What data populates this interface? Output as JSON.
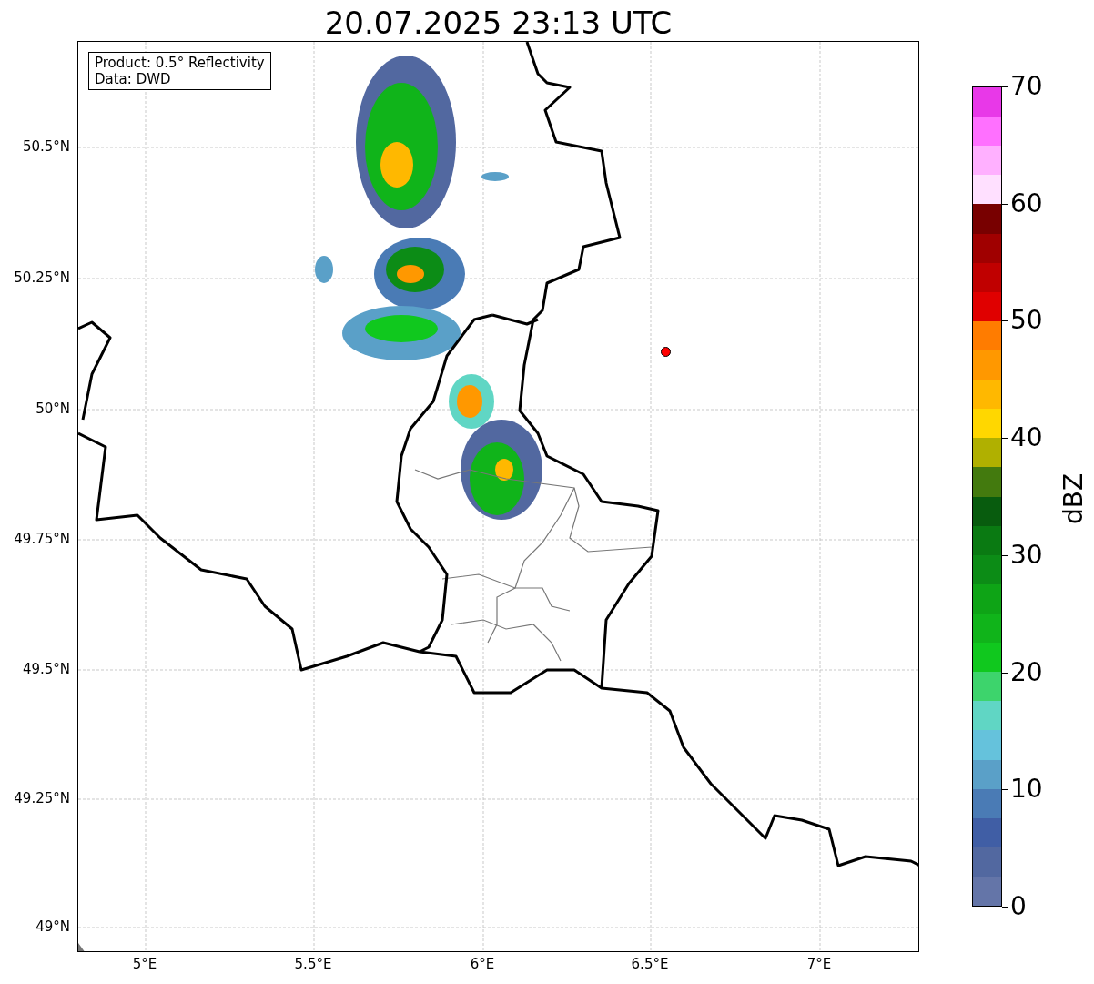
{
  "title": "20.07.2025 23:13 UTC",
  "info_box": [
    "Product: 0.5° Reflectivity",
    "Data: DWD"
  ],
  "map": {
    "lat_labels": [
      "50.5°N",
      "50.25°N",
      "50°N",
      "49.75°N",
      "49.5°N",
      "49.25°N",
      "49°N"
    ],
    "lon_labels": [
      "5°E",
      "5.5°E",
      "6°E",
      "6.5°E",
      "7°E"
    ]
  },
  "colorbar": {
    "label": "dBZ",
    "ticks": [
      "70",
      "60",
      "50",
      "40",
      "30",
      "20",
      "10",
      "0"
    ],
    "bins": [
      {
        "color": "#e838e8"
      },
      {
        "color": "#ff70ff"
      },
      {
        "color": "#ffb0ff"
      },
      {
        "color": "#ffe0ff"
      },
      {
        "color": "#780000"
      },
      {
        "color": "#a00000"
      },
      {
        "color": "#c00000"
      },
      {
        "color": "#e00000"
      },
      {
        "color": "#ff7c00"
      },
      {
        "color": "#ff9800"
      },
      {
        "color": "#ffb800"
      },
      {
        "color": "#ffd700"
      },
      {
        "color": "#b0b000"
      },
      {
        "color": "#437a0e"
      },
      {
        "color": "#085c0e"
      },
      {
        "color": "#0a7a12"
      },
      {
        "color": "#0c8c16"
      },
      {
        "color": "#0ea416"
      },
      {
        "color": "#10b41a"
      },
      {
        "color": "#10c81e"
      },
      {
        "color": "#3dd46c"
      },
      {
        "color": "#60d6c4"
      },
      {
        "color": "#65c2dc"
      },
      {
        "color": "#5aa0c8"
      },
      {
        "color": "#4a7bb5"
      },
      {
        "color": "#405ea5"
      },
      {
        "color": "#5268a0"
      },
      {
        "color": "#6475a8"
      }
    ]
  }
}
